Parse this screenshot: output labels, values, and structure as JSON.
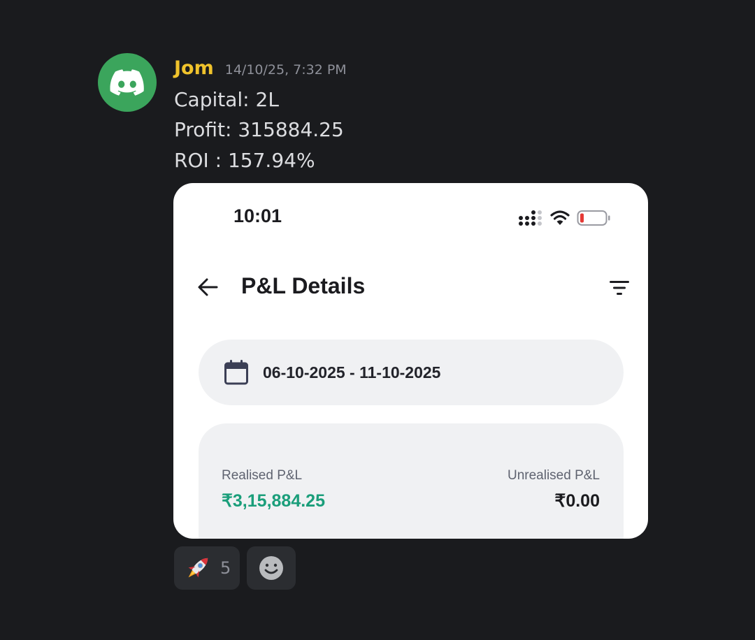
{
  "message": {
    "author": "Jom",
    "timestamp": "14/10/25, 7:32 PM",
    "lines": [
      "Capital: 2L",
      "Profit: 315884.25",
      "ROI : 157.94%"
    ]
  },
  "embed": {
    "status_time": "10:01",
    "page_title": "P&L Details",
    "date_range": "06-10-2025 - 11-10-2025",
    "realised_label": "Realised P&L",
    "realised_value": "₹3,15,884.25",
    "unrealised_label": "Unrealised P&L",
    "unrealised_value": "₹0.00",
    "colors": {
      "profit": "#1a9e7a",
      "battery_low": "#e53935"
    }
  },
  "reactions": {
    "rocket_count": "5",
    "rocket_icon": "rocket-emoji",
    "add_reaction_icon": "smiley-icon"
  },
  "colors": {
    "background": "#1a1b1e",
    "username": "#f0c32c",
    "avatar": "#3ba55c"
  }
}
